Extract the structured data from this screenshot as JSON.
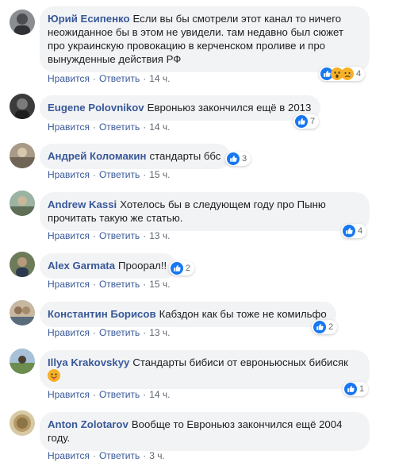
{
  "actions": {
    "like": "Нравится",
    "reply": "Ответить",
    "sep": "·"
  },
  "colors": {
    "link": "#385898",
    "bubble": "#f2f3f5",
    "like_blue": "#1877f2"
  },
  "comments": [
    {
      "author": "Юрий Есипенко",
      "text": "Если вы бы смотрели этот канал то ничего неожиданное бы в этом не увидели. там недавно был сюжет про украинскую провокацию в керченском проливе и про вынужденные действия РФ",
      "reactions": [
        "like-icon",
        "wow-icon",
        "sad-icon"
      ],
      "count": "4",
      "time": "14 ч."
    },
    {
      "author": "Eugene Polovnikov",
      "text": "Евроньюз закончился ещё в 2013",
      "reactions": [
        "like-icon"
      ],
      "count": "7",
      "time": "14 ч."
    },
    {
      "author": "Андрей Коломакин",
      "text": "стандарты ббс",
      "reactions": [
        "like-icon"
      ],
      "count": "3",
      "time": "15 ч."
    },
    {
      "author": "Andrew Kassi",
      "text": "Хотелось бы в следующем году про Пыню прочитать такую же статью.",
      "reactions": [
        "like-icon"
      ],
      "count": "4",
      "time": "13 ч."
    },
    {
      "author": "Alex Garmata",
      "text": "Проорал!!",
      "reactions": [
        "like-icon"
      ],
      "count": "2",
      "time": "15 ч."
    },
    {
      "author": "Константин Борисов",
      "text": "Кабздон как бы тоже не комильфо",
      "reactions": [
        "like-icon"
      ],
      "count": "2",
      "time": "13 ч."
    },
    {
      "author": "Illya Krakovskyy",
      "text": "Стандарты бибиси от евроньюсных бибисяк",
      "reactions": [
        "like-icon"
      ],
      "count": "1",
      "time": "14 ч."
    },
    {
      "author": "Anton Zolotarov",
      "text": "Вообще то Евроньюз закончился ещё 2004 году.",
      "reactions": [],
      "count": "",
      "time": "3 ч."
    }
  ]
}
